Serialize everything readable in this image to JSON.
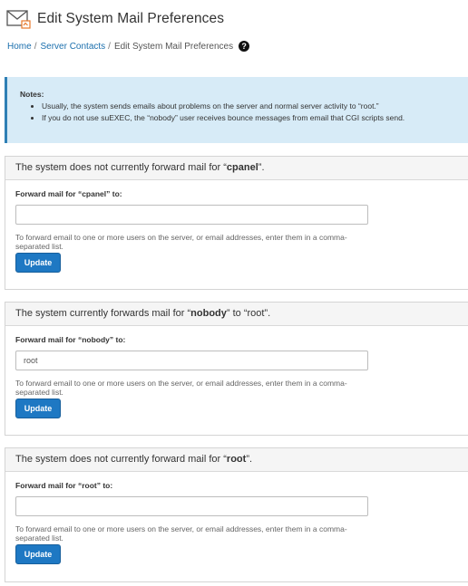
{
  "header": {
    "title": "Edit System Mail Preferences",
    "icon": "mail-icon"
  },
  "breadcrumb": {
    "items": [
      "Home",
      "Server Contacts"
    ],
    "current": "Edit System Mail Preferences",
    "help_icon": "?"
  },
  "notes": {
    "label": "Notes:",
    "items": [
      "Usually, the system sends emails about problems on the server and normal server activity to “root.”",
      "If you do not use suEXEC, the “nobody” user receives bounce messages from email that CGI scripts send."
    ]
  },
  "panels": [
    {
      "heading_prefix": "The system does not currently forward mail for “",
      "user": "cpanel",
      "heading_suffix": "”.",
      "label": "Forward mail for “cpanel” to:",
      "value": "",
      "help": "To forward email to one or more users on the server, or email addresses, enter them in a comma-separated list.",
      "button": "Update"
    },
    {
      "heading_prefix": "The system currently forwards mail for “",
      "user": "nobody",
      "heading_suffix": "” to “root”.",
      "label": "Forward mail for “nobody” to:",
      "value": "root",
      "help": "To forward email to one or more users on the server, or email addresses, enter them in a comma-separated list.",
      "button": "Update"
    },
    {
      "heading_prefix": "The system does not currently forward mail for “",
      "user": "root",
      "heading_suffix": "”.",
      "label": "Forward mail for “root” to:",
      "value": "",
      "help": "To forward email to one or more users on the server, or email addresses, enter them in a comma-separated list.",
      "button": "Update"
    }
  ],
  "colors": {
    "link": "#1b6fad",
    "notes_bg": "#d7ebf7",
    "notes_border": "#2e7fb5",
    "button_bg": "#1e78c3"
  }
}
